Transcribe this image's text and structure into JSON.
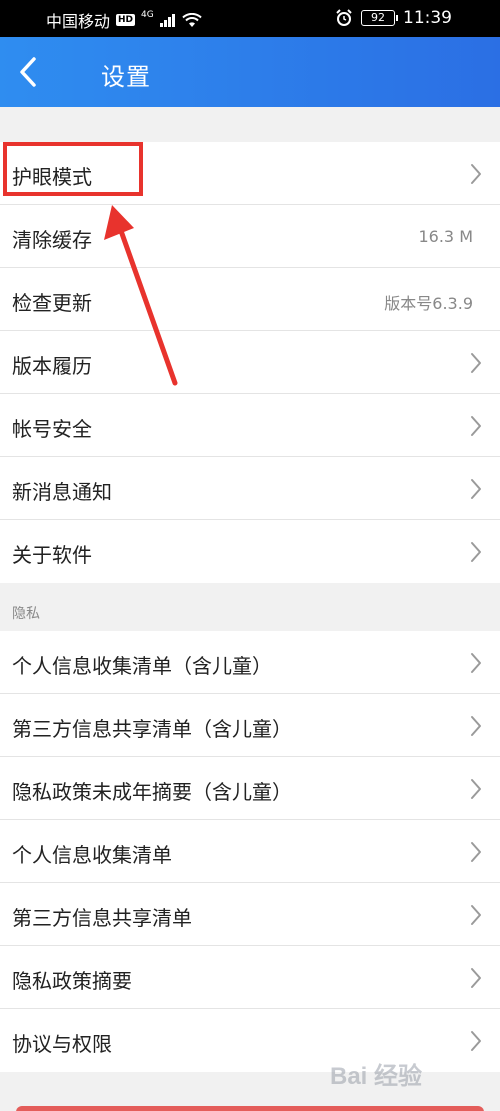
{
  "status_bar": {
    "carrier": "中国移动",
    "hd_badge": "HD",
    "network": "4G",
    "battery": "92",
    "time": "11:39"
  },
  "header": {
    "title": "设置"
  },
  "settings": [
    {
      "label": "护眼模式",
      "value": "",
      "chevron": true
    },
    {
      "label": "清除缓存",
      "value": "16.3 M",
      "chevron": false
    },
    {
      "label": "检查更新",
      "value": "版本号6.3.9",
      "chevron": false
    },
    {
      "label": "版本履历",
      "value": "",
      "chevron": true
    },
    {
      "label": "帐号安全",
      "value": "",
      "chevron": true
    },
    {
      "label": "新消息通知",
      "value": "",
      "chevron": true
    },
    {
      "label": "关于软件",
      "value": "",
      "chevron": true
    }
  ],
  "privacy": {
    "section_label": "隐私",
    "items": [
      {
        "label": "个人信息收集清单（含儿童）"
      },
      {
        "label": "第三方信息共享清单（含儿童）"
      },
      {
        "label": "隐私政策未成年摘要（含儿童）"
      },
      {
        "label": "个人信息收集清单"
      },
      {
        "label": "第三方信息共享清单"
      },
      {
        "label": "隐私政策摘要"
      },
      {
        "label": "协议与权限"
      }
    ]
  },
  "annotation": {
    "color": "#e8332d"
  },
  "watermark": {
    "text": "Bai 经验"
  },
  "colors": {
    "header_start": "#2f8df0",
    "header_end": "#2b6fe4",
    "background": "#f1f1f1",
    "text_primary": "#222222",
    "text_secondary": "#888888"
  }
}
